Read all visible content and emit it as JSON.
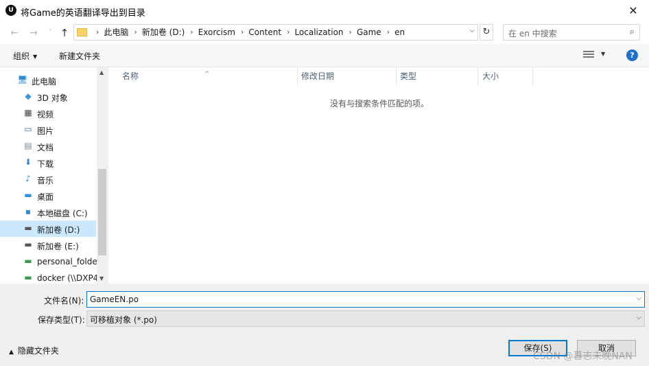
{
  "window": {
    "title": "将Game的英语翻译导出到目录",
    "app_icon_text": "U",
    "close_glyph": "✕"
  },
  "nav": {
    "back": "←",
    "forward": "→",
    "recent": "˅",
    "up": "↑",
    "breadcrumbs": [
      "此电脑",
      "新加卷 (D:)",
      "Exorcism",
      "Content",
      "Localization",
      "Game",
      "en"
    ],
    "refresh": "↻",
    "search_placeholder": "在 en 中搜索",
    "search_icon": "⌕"
  },
  "toolbar": {
    "organize": "组织",
    "new_folder": "新建文件夹",
    "help": "?"
  },
  "sidebar": {
    "items": [
      {
        "label": "此电脑",
        "icon": "computer-icon",
        "glyph": "🖥",
        "color": "#2e8bd6"
      },
      {
        "label": "3D 对象",
        "icon": "cube-3d-icon",
        "glyph": "◆",
        "color": "#3a9ad9"
      },
      {
        "label": "视频",
        "icon": "video-icon",
        "glyph": "▦",
        "color": "#444444"
      },
      {
        "label": "图片",
        "icon": "picture-icon",
        "glyph": "▭",
        "color": "#3c6fa8"
      },
      {
        "label": "文档",
        "icon": "document-icon",
        "glyph": "▤",
        "color": "#7a8a9a"
      },
      {
        "label": "下载",
        "icon": "download-icon",
        "glyph": "⬇",
        "color": "#2f7fd1"
      },
      {
        "label": "音乐",
        "icon": "music-icon",
        "glyph": "♪",
        "color": "#2f7fd1"
      },
      {
        "label": "桌面",
        "icon": "desktop-icon",
        "glyph": "▬",
        "color": "#2f8fe0"
      },
      {
        "label": "本地磁盘 (C:)",
        "icon": "system-drive-icon",
        "glyph": "▪",
        "color": "#3c8bd5"
      },
      {
        "label": "新加卷 (D:)",
        "icon": "drive-icon",
        "glyph": "▬",
        "color": "#555555"
      },
      {
        "label": "新加卷 (E:)",
        "icon": "drive-icon",
        "glyph": "▬",
        "color": "#555555"
      },
      {
        "label": "personal_folde",
        "icon": "network-drive-icon",
        "glyph": "▬",
        "color": "#3a9a4a"
      },
      {
        "label": "docker (\\\\DXP4",
        "icon": "network-drive-icon",
        "glyph": "▬",
        "color": "#3a9a4a"
      }
    ],
    "selected_index": 9
  },
  "columns": [
    "名称",
    "修改日期",
    "类型",
    "大小"
  ],
  "empty_message": "没有与搜索条件匹配的项。",
  "form": {
    "filename_label": "文件名(N):",
    "filename_value": "GameEN.po",
    "filetype_label": "保存类型(T):",
    "filetype_value": "可移植对象 (*.po)"
  },
  "footer": {
    "hide_folders": "隐藏文件夹",
    "save": "保存(S)",
    "cancel": "取消",
    "watermark": "CSDN @暮志未晚NAN"
  }
}
